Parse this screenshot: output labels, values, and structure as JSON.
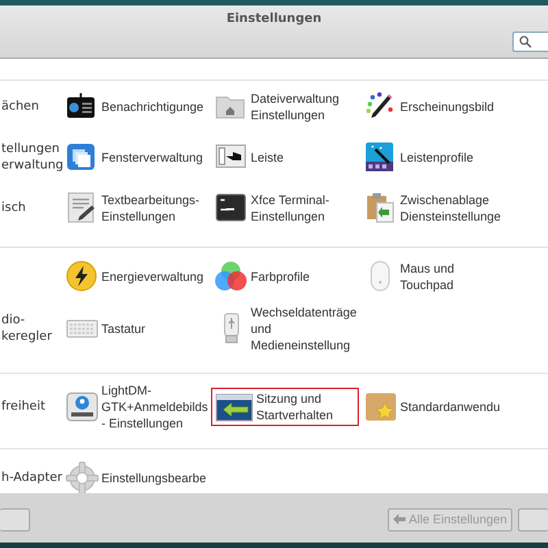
{
  "window": {
    "title": "Einstellungen"
  },
  "sections": [
    {
      "rows": [
        [
          {
            "kind": "cut",
            "label": "ächen",
            "selected": false
          },
          {
            "kind": "full",
            "label": "Benachrichtigunge",
            "selected": false
          },
          {
            "kind": "full",
            "label": "Dateiverwaltung Einstellungen",
            "selected": false
          },
          {
            "kind": "full",
            "label": "Erscheinungsbild",
            "selected": false
          }
        ],
        [
          {
            "kind": "cut",
            "label": "tellungen\nerwaltung",
            "selected": false
          },
          {
            "kind": "full",
            "label": "Fensterverwaltung",
            "selected": false
          },
          {
            "kind": "full",
            "label": "Leiste",
            "selected": false
          },
          {
            "kind": "full",
            "label": "Leistenprofile",
            "selected": false
          }
        ],
        [
          {
            "kind": "cut",
            "label": "isch",
            "selected": false
          },
          {
            "kind": "full",
            "label": "Textbearbeitungs-Einstellungen",
            "selected": false
          },
          {
            "kind": "full",
            "label": "Xfce Terminal-Einstellungen",
            "selected": false
          },
          {
            "kind": "full",
            "label": "Zwischenablage Diensteinstellunge",
            "selected": false
          }
        ]
      ]
    },
    {
      "rows": [
        [
          "",
          {
            "kind": "full",
            "label": "Energieverwaltung",
            "selected": false
          },
          {
            "kind": "full",
            "label": "Farbprofile",
            "selected": false
          },
          {
            "kind": "full",
            "label": "Maus und Touchpad",
            "selected": false
          }
        ],
        [
          {
            "kind": "cut",
            "label": "dio-\nkeregler",
            "selected": false
          },
          {
            "kind": "full",
            "label": "Tastatur",
            "selected": false
          },
          {
            "kind": "full",
            "label": "Wechseldatenträge und Medieneinstellung",
            "selected": false
          }
        ]
      ]
    },
    {
      "rows": [
        [
          {
            "kind": "cut",
            "label": "freiheit",
            "selected": false
          },
          {
            "kind": "full",
            "label": "LightDM-GTK+Anmeldebilds - Einstellungen",
            "selected": false
          },
          {
            "kind": "full",
            "label": "Sitzung und Startverhalten",
            "selected": true
          },
          {
            "kind": "full",
            "label": "Standardanwendu",
            "selected": false
          }
        ]
      ]
    },
    {
      "rows": [
        [
          {
            "kind": "cut",
            "label": "h-Adapter",
            "selected": false
          },
          {
            "kind": "full",
            "label": "Einstellungsbearbe",
            "selected": false
          }
        ]
      ]
    }
  ],
  "footer": {
    "back_button": {
      "label": "Alle Einstellungen",
      "disabled": true
    }
  }
}
